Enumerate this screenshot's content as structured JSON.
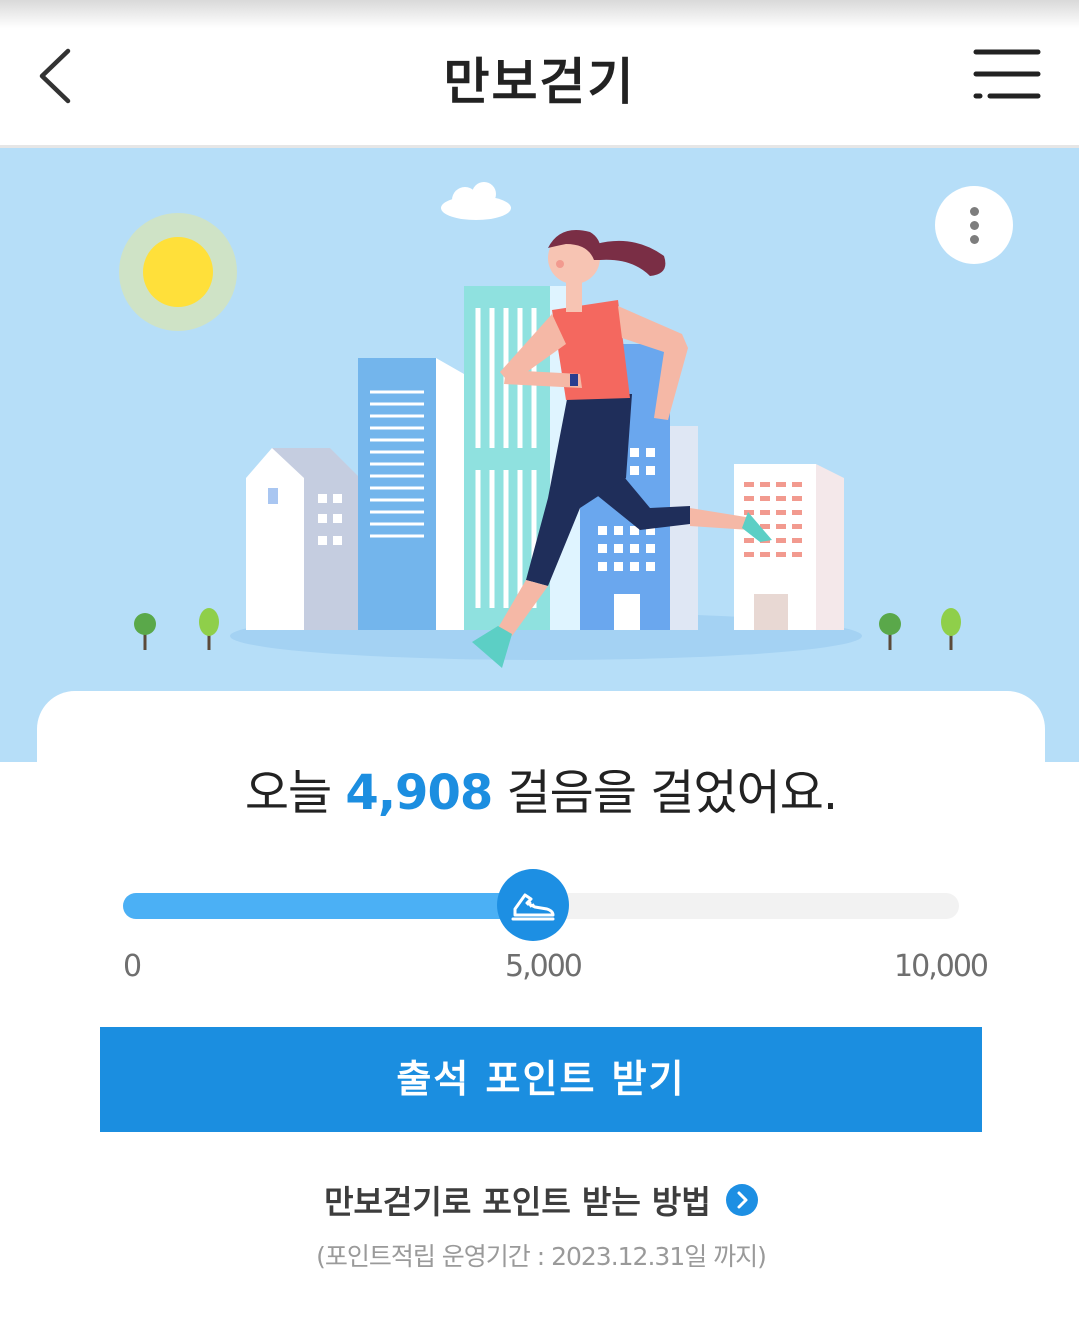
{
  "header": {
    "title": "만보걷기"
  },
  "steps": {
    "prefix": "오늘",
    "count": "4,908",
    "suffix": "걸음을 걸었어요."
  },
  "progress": {
    "value": 4908,
    "min": 0,
    "max": 10000,
    "marker": 5000,
    "labels": [
      "0",
      "5,000",
      "10,000"
    ]
  },
  "actions": {
    "claim_button": "출석 포인트 받기",
    "how_to_link": "만보걷기로 포인트 받는 방법"
  },
  "footnote": "(포인트적립 운영기간 : 2023.12.31일 까지)",
  "icons": {
    "back": "chevron-left-icon",
    "menu": "hamburger-menu-icon",
    "more": "more-vertical-icon",
    "thumb": "sneaker-icon",
    "link": "chevron-right-icon"
  },
  "colors": {
    "accent": "#1b8ee0",
    "progress_fill": "#4bb0f5",
    "hero_bg": "#b6def8"
  }
}
